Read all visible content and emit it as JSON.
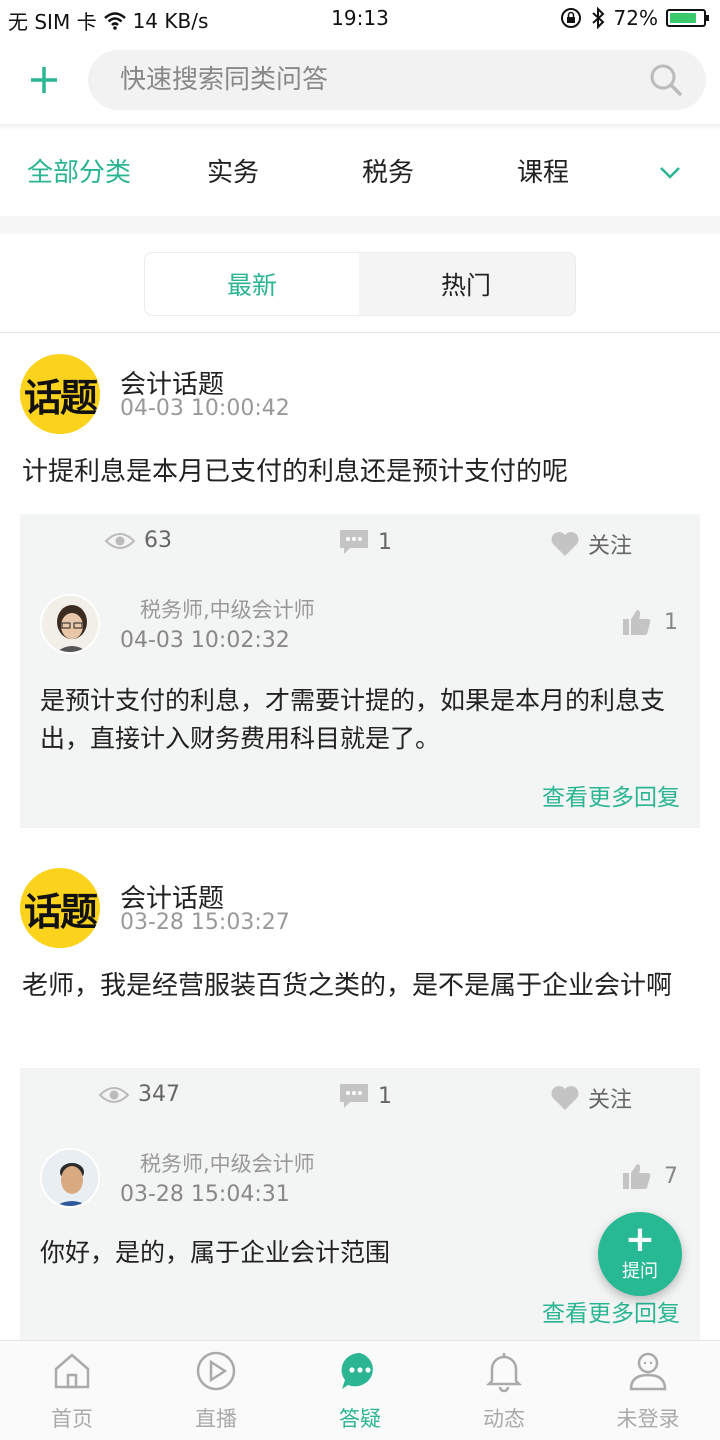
{
  "status": {
    "carrier": "无 SIM 卡",
    "speed": "14 KB/s",
    "time": "19:13",
    "battery": "72%"
  },
  "search": {
    "placeholder": "快速搜索同类问答"
  },
  "categories": [
    "全部分类",
    "实务",
    "税务",
    "课程"
  ],
  "segments": {
    "latest": "最新",
    "hot": "热门"
  },
  "posts": [
    {
      "avatar_text": "话题",
      "author": "会计话题",
      "time": "04-03 10:00:42",
      "question": "计提利息是本月已支付的利息还是预计支付的呢",
      "views": "63",
      "comments": "1",
      "follow": "关注",
      "responder_title": "税务师,中级会计师",
      "responder_time": "04-03 10:02:32",
      "likes": "1",
      "answer": "是预计支付的利息，才需要计提的，如果是本月的利息支出，直接计入财务费用科目就是了。",
      "more": "查看更多回复"
    },
    {
      "avatar_text": "话题",
      "author": "会计话题",
      "time": "03-28 15:03:27",
      "question": "老师，我是经营服装百货之类的，是不是属于企业会计啊",
      "views": "347",
      "comments": "1",
      "follow": "关注",
      "responder_title": "税务师,中级会计师",
      "responder_time": "03-28 15:04:31",
      "likes": "7",
      "answer": "你好，是的，属于企业会计范围",
      "more": "查看更多回复"
    }
  ],
  "fab": {
    "label": "提问"
  },
  "tabs": [
    "首页",
    "直播",
    "答疑",
    "动态",
    "未登录"
  ],
  "colors": {
    "accent": "#2bb593",
    "topic_avatar": "#fbd31c"
  }
}
